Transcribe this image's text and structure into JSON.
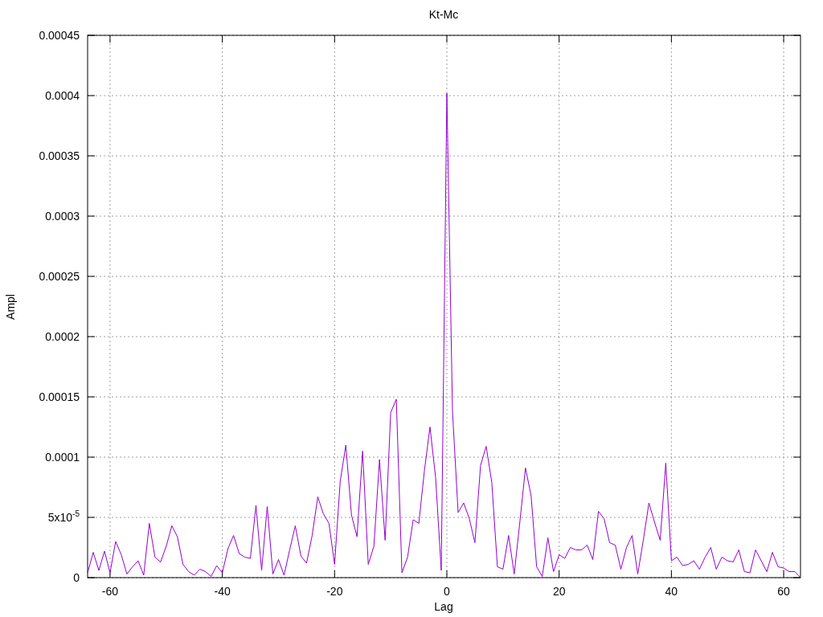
{
  "chart_data": {
    "type": "line",
    "grid": true,
    "title": "Kt-Mc",
    "xlabel": "Lag",
    "ylabel": "Ampl",
    "xlim": [
      -64,
      63
    ],
    "ylim": [
      0,
      0.00045
    ],
    "xticks": [
      -60,
      -40,
      -20,
      0,
      20,
      40,
      60
    ],
    "yticks": [
      {
        "value": 0,
        "label": "0"
      },
      {
        "value": 5e-05,
        "label": "5x10$^{-5}$"
      },
      {
        "value": 0.0001,
        "label": "0.0001"
      },
      {
        "value": 0.00015,
        "label": "0.00015"
      },
      {
        "value": 0.0002,
        "label": "0.0002"
      },
      {
        "value": 0.00025,
        "label": "0.00025"
      },
      {
        "value": 0.0003,
        "label": "0.0003"
      },
      {
        "value": 0.00035,
        "label": "0.00035"
      },
      {
        "value": 0.0004,
        "label": "0.0004"
      },
      {
        "value": 0.00045,
        "label": "0.00045"
      }
    ],
    "x": [
      -64,
      -63,
      -62,
      -61,
      -60,
      -59,
      -58,
      -57,
      -56,
      -55,
      -54,
      -53,
      -52,
      -51,
      -50,
      -49,
      -48,
      -47,
      -46,
      -45,
      -44,
      -43,
      -42,
      -41,
      -40,
      -39,
      -38,
      -37,
      -36,
      -35,
      -34,
      -33,
      -32,
      -31,
      -30,
      -29,
      -28,
      -27,
      -26,
      -25,
      -24,
      -23,
      -22,
      -21,
      -20,
      -19,
      -18,
      -17,
      -16,
      -15,
      -14,
      -13,
      -12,
      -11,
      -10,
      -9,
      -8,
      -7,
      -6,
      -5,
      -4,
      -3,
      -2,
      -1,
      0,
      1,
      2,
      3,
      4,
      5,
      6,
      7,
      8,
      9,
      10,
      11,
      12,
      13,
      14,
      15,
      16,
      17,
      18,
      19,
      20,
      21,
      22,
      23,
      24,
      25,
      26,
      27,
      28,
      29,
      30,
      31,
      32,
      33,
      34,
      35,
      36,
      37,
      38,
      39,
      40,
      41,
      42,
      43,
      44,
      45,
      46,
      47,
      48,
      49,
      50,
      51,
      52,
      53,
      54,
      55,
      56,
      57,
      58,
      59,
      60,
      61,
      62,
      63
    ],
    "series": [
      {
        "color": "#9400d3",
        "values": [
          4e-06,
          2.1e-05,
          6e-06,
          2.2e-05,
          4e-06,
          3e-05,
          1.9e-05,
          3e-06,
          9e-06,
          1.4e-05,
          2e-06,
          4.5e-05,
          1.7e-05,
          1.3e-05,
          2.6e-05,
          4.3e-05,
          3.4e-05,
          1.1e-05,
          5e-06,
          2e-06,
          7e-06,
          5e-06,
          1e-06,
          1e-05,
          4e-06,
          2.4e-05,
          3.5e-05,
          2e-05,
          1.7e-05,
          1.6e-05,
          6e-05,
          6e-06,
          5.9e-05,
          3e-06,
          1.5e-05,
          2e-06,
          2.3e-05,
          4.3e-05,
          1.8e-05,
          1.2e-05,
          3.5e-05,
          6.7e-05,
          5.3e-05,
          4.5e-05,
          1.1e-05,
          8e-05,
          0.00011,
          5.2e-05,
          3.4e-05,
          0.000105,
          1.1e-05,
          2.6e-05,
          9.8e-05,
          3.1e-05,
          0.000137,
          0.000148,
          4e-06,
          1.7e-05,
          4.8e-05,
          4.5e-05,
          8.9e-05,
          0.000125,
          8.3e-05,
          6e-06,
          0.000402,
          0.000138,
          5.4e-05,
          6.2e-05,
          4.9e-05,
          2.9e-05,
          9.3e-05,
          0.000109,
          7.9e-05,
          9e-06,
          7e-06,
          3.5e-05,
          3e-06,
          4.6e-05,
          9.1e-05,
          6.8e-05,
          9e-06,
          1e-06,
          3.3e-05,
          5e-06,
          1.9e-05,
          1.6e-05,
          2.5e-05,
          2.3e-05,
          2.3e-05,
          2.7e-05,
          1.5e-05,
          5.5e-05,
          4.9e-05,
          2.9e-05,
          2.7e-05,
          7e-06,
          2.5e-05,
          3.5e-05,
          3e-06,
          3.1e-05,
          6.2e-05,
          4.6e-05,
          3.1e-05,
          9.5e-05,
          1.4e-05,
          1.7e-05,
          1e-05,
          1.1e-05,
          1.4e-05,
          7e-06,
          1.7e-05,
          2.5e-05,
          7e-06,
          1.7e-05,
          1.4e-05,
          1.3e-05,
          2.3e-05,
          5e-06,
          4e-06,
          2.3e-05,
          1.4e-05,
          5e-06,
          2.1e-05,
          9e-06,
          8e-06,
          5e-06,
          5e-06,
          0
        ]
      }
    ]
  }
}
